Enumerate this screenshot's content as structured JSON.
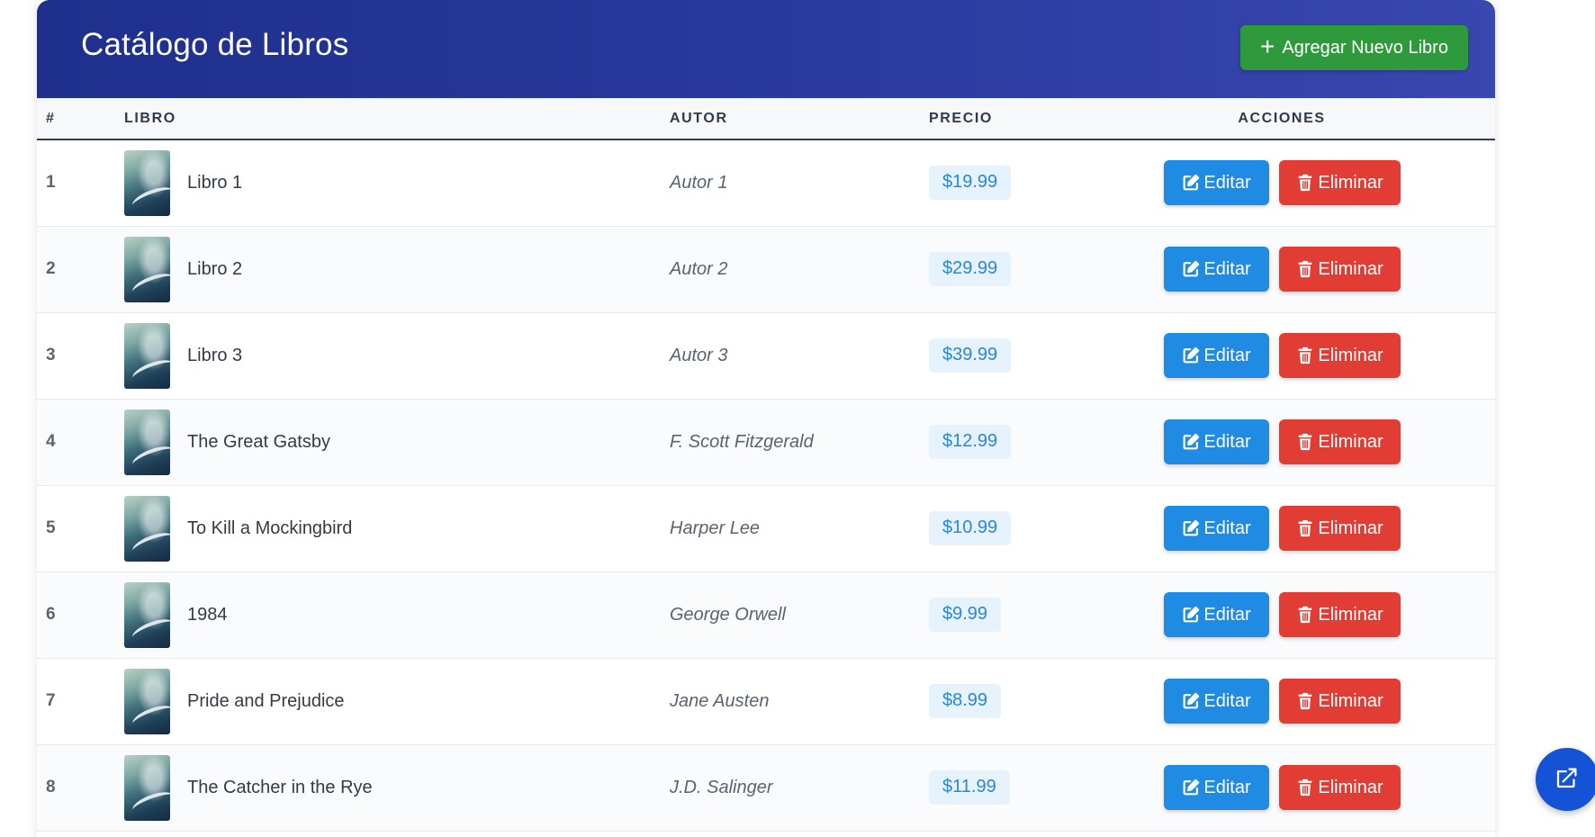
{
  "header": {
    "title": "Catálogo de Libros",
    "add_button_label": "Agregar Nuevo Libro",
    "add_button_icon": "plus-icon",
    "background_color": "#26359a",
    "add_button_color": "#2e9a3c"
  },
  "table": {
    "columns": [
      "#",
      "LIBRO",
      "AUTOR",
      "PRECIO",
      "ACCIONES"
    ],
    "edit_label": "Editar",
    "delete_label": "Eliminar",
    "edit_icon": "edit-icon",
    "delete_icon": "trash-icon",
    "edit_color": "#1f8be2",
    "delete_color": "#e23d35",
    "price_color": "#2a86d8",
    "rows": [
      {
        "num": "1",
        "title": "Libro 1",
        "author": "Autor 1",
        "price": "$19.99"
      },
      {
        "num": "2",
        "title": "Libro 2",
        "author": "Autor 2",
        "price": "$29.99"
      },
      {
        "num": "3",
        "title": "Libro 3",
        "author": "Autor 3",
        "price": "$39.99"
      },
      {
        "num": "4",
        "title": "The Great Gatsby",
        "author": "F. Scott Fitzgerald",
        "price": "$12.99"
      },
      {
        "num": "5",
        "title": "To Kill a Mockingbird",
        "author": "Harper Lee",
        "price": "$10.99"
      },
      {
        "num": "6",
        "title": "1984",
        "author": "George Orwell",
        "price": "$9.99"
      },
      {
        "num": "7",
        "title": "Pride and Prejudice",
        "author": "Jane Austen",
        "price": "$8.99"
      },
      {
        "num": "8",
        "title": "The Catcher in the Rye",
        "author": "J.D. Salinger",
        "price": "$11.99"
      }
    ]
  },
  "floating_button": {
    "icon": "external-link-icon",
    "color": "#1553d6"
  }
}
